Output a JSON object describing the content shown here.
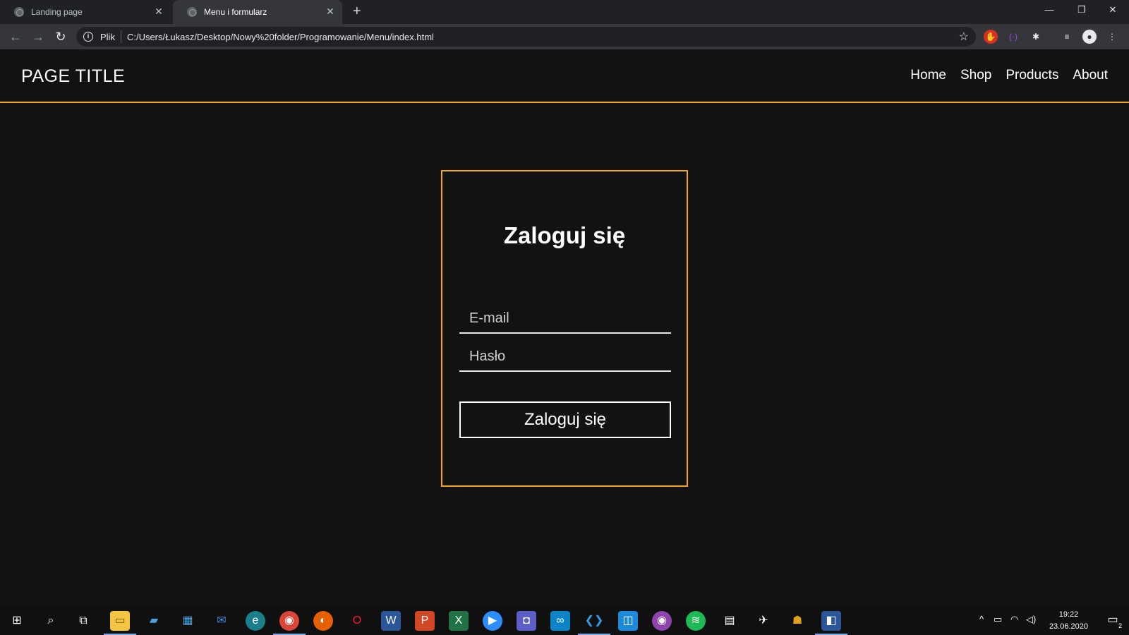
{
  "browser": {
    "tabs": [
      {
        "label": "Landing page",
        "active": false
      },
      {
        "label": "Menu i formularz",
        "active": true
      }
    ],
    "address": {
      "scheme_label": "Plik",
      "url": "C:/Users/Łukasz/Desktop/Nowy%20folder/Programowanie/Menu/index.html"
    }
  },
  "site": {
    "title": "PAGE TITLE",
    "nav": [
      "Home",
      "Shop",
      "Products",
      "About"
    ],
    "accent_color": "#f5a623"
  },
  "login": {
    "heading": "Zaloguj się",
    "email_placeholder": "E-mail",
    "password_placeholder": "Hasło",
    "submit_label": "Zaloguj się"
  },
  "taskbar": {
    "time": "19:22",
    "date": "23.06.2020",
    "notification_count": "2"
  }
}
